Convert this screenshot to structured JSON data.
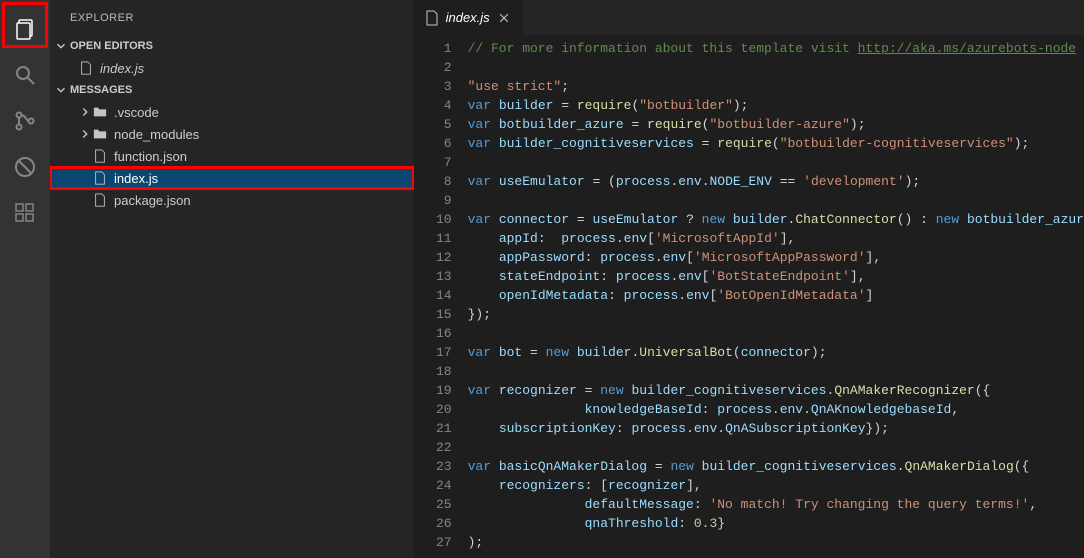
{
  "activityBar": {
    "items": [
      "explorer",
      "search",
      "source-control",
      "debug",
      "extensions"
    ]
  },
  "sidebar": {
    "title": "EXPLORER",
    "openEditorsLabel": "OPEN EDITORS",
    "openEditors": [
      {
        "label": "index.js"
      }
    ],
    "workspaceLabel": "MESSAGES",
    "tree": [
      {
        "type": "folder",
        "label": ".vscode",
        "indent": 1
      },
      {
        "type": "folder",
        "label": "node_modules",
        "indent": 1
      },
      {
        "type": "file",
        "label": "function.json",
        "indent": 1
      },
      {
        "type": "file",
        "label": "index.js",
        "indent": 1,
        "selected": true,
        "highlighted": true
      },
      {
        "type": "file",
        "label": "package.json",
        "indent": 1
      }
    ]
  },
  "tabs": {
    "items": [
      {
        "label": "index.js",
        "active": true
      }
    ]
  },
  "code": {
    "lines": [
      {
        "n": 1,
        "t": "comment",
        "txt": "// For more information about this template visit ",
        "link": "http://aka.ms/azurebots-node"
      },
      {
        "n": 2,
        "t": "blank"
      },
      {
        "n": 3,
        "tokens": [
          [
            "string",
            "\"use strict\""
          ],
          [
            "plain",
            ";"
          ]
        ]
      },
      {
        "n": 4,
        "tokens": [
          [
            "keyword",
            "var "
          ],
          [
            "var",
            "builder"
          ],
          [
            "plain",
            " = "
          ],
          [
            "func",
            "require"
          ],
          [
            "plain",
            "("
          ],
          [
            "string",
            "\"botbuilder\""
          ],
          [
            "plain",
            ");"
          ]
        ]
      },
      {
        "n": 5,
        "tokens": [
          [
            "keyword",
            "var "
          ],
          [
            "var",
            "botbuilder_azure"
          ],
          [
            "plain",
            " = "
          ],
          [
            "func",
            "require"
          ],
          [
            "plain",
            "("
          ],
          [
            "string",
            "\"botbuilder-azure\""
          ],
          [
            "plain",
            ");"
          ]
        ]
      },
      {
        "n": 6,
        "tokens": [
          [
            "keyword",
            "var "
          ],
          [
            "var",
            "builder_cognitiveservices"
          ],
          [
            "plain",
            " = "
          ],
          [
            "func",
            "require"
          ],
          [
            "plain",
            "("
          ],
          [
            "string",
            "\"botbuilder-cognitiveservices\""
          ],
          [
            "plain",
            ");"
          ]
        ]
      },
      {
        "n": 7,
        "t": "blank"
      },
      {
        "n": 8,
        "tokens": [
          [
            "keyword",
            "var "
          ],
          [
            "var",
            "useEmulator"
          ],
          [
            "plain",
            " = ("
          ],
          [
            "var",
            "process"
          ],
          [
            "plain",
            "."
          ],
          [
            "var",
            "env"
          ],
          [
            "plain",
            "."
          ],
          [
            "var",
            "NODE_ENV"
          ],
          [
            "plain",
            " == "
          ],
          [
            "string",
            "'development'"
          ],
          [
            "plain",
            ");"
          ]
        ]
      },
      {
        "n": 9,
        "t": "blank"
      },
      {
        "n": 10,
        "tokens": [
          [
            "keyword",
            "var "
          ],
          [
            "var",
            "connector"
          ],
          [
            "plain",
            " = "
          ],
          [
            "var",
            "useEmulator"
          ],
          [
            "plain",
            " ? "
          ],
          [
            "keyword",
            "new "
          ],
          [
            "var",
            "builder"
          ],
          [
            "plain",
            "."
          ],
          [
            "func",
            "ChatConnector"
          ],
          [
            "plain",
            "() : "
          ],
          [
            "keyword",
            "new "
          ],
          [
            "var",
            "botbuilder_azur"
          ]
        ]
      },
      {
        "n": 11,
        "tokens": [
          [
            "plain",
            "    "
          ],
          [
            "var",
            "appId"
          ],
          [
            "plain",
            ":  "
          ],
          [
            "var",
            "process"
          ],
          [
            "plain",
            "."
          ],
          [
            "var",
            "env"
          ],
          [
            "plain",
            "["
          ],
          [
            "string",
            "'MicrosoftAppId'"
          ],
          [
            "plain",
            "],"
          ]
        ]
      },
      {
        "n": 12,
        "tokens": [
          [
            "plain",
            "    "
          ],
          [
            "var",
            "appPassword"
          ],
          [
            "plain",
            ": "
          ],
          [
            "var",
            "process"
          ],
          [
            "plain",
            "."
          ],
          [
            "var",
            "env"
          ],
          [
            "plain",
            "["
          ],
          [
            "string",
            "'MicrosoftAppPassword'"
          ],
          [
            "plain",
            "],"
          ]
        ]
      },
      {
        "n": 13,
        "tokens": [
          [
            "plain",
            "    "
          ],
          [
            "var",
            "stateEndpoint"
          ],
          [
            "plain",
            ": "
          ],
          [
            "var",
            "process"
          ],
          [
            "plain",
            "."
          ],
          [
            "var",
            "env"
          ],
          [
            "plain",
            "["
          ],
          [
            "string",
            "'BotStateEndpoint'"
          ],
          [
            "plain",
            "],"
          ]
        ]
      },
      {
        "n": 14,
        "tokens": [
          [
            "plain",
            "    "
          ],
          [
            "var",
            "openIdMetadata"
          ],
          [
            "plain",
            ": "
          ],
          [
            "var",
            "process"
          ],
          [
            "plain",
            "."
          ],
          [
            "var",
            "env"
          ],
          [
            "plain",
            "["
          ],
          [
            "string",
            "'BotOpenIdMetadata'"
          ],
          [
            "plain",
            "]"
          ]
        ]
      },
      {
        "n": 15,
        "tokens": [
          [
            "plain",
            "});"
          ]
        ]
      },
      {
        "n": 16,
        "t": "blank"
      },
      {
        "n": 17,
        "tokens": [
          [
            "keyword",
            "var "
          ],
          [
            "var",
            "bot"
          ],
          [
            "plain",
            " = "
          ],
          [
            "keyword",
            "new "
          ],
          [
            "var",
            "builder"
          ],
          [
            "plain",
            "."
          ],
          [
            "func",
            "UniversalBot"
          ],
          [
            "plain",
            "("
          ],
          [
            "var",
            "connector"
          ],
          [
            "plain",
            ");"
          ]
        ]
      },
      {
        "n": 18,
        "t": "blank"
      },
      {
        "n": 19,
        "tokens": [
          [
            "keyword",
            "var "
          ],
          [
            "var",
            "recognizer"
          ],
          [
            "plain",
            " = "
          ],
          [
            "keyword",
            "new "
          ],
          [
            "var",
            "builder_cognitiveservices"
          ],
          [
            "plain",
            "."
          ],
          [
            "func",
            "QnAMakerRecognizer"
          ],
          [
            "plain",
            "({"
          ]
        ]
      },
      {
        "n": 20,
        "tokens": [
          [
            "plain",
            "               "
          ],
          [
            "var",
            "knowledgeBaseId"
          ],
          [
            "plain",
            ": "
          ],
          [
            "var",
            "process"
          ],
          [
            "plain",
            "."
          ],
          [
            "var",
            "env"
          ],
          [
            "plain",
            "."
          ],
          [
            "var",
            "QnAKnowledgebaseId"
          ],
          [
            "plain",
            ","
          ]
        ]
      },
      {
        "n": 21,
        "tokens": [
          [
            "plain",
            "    "
          ],
          [
            "var",
            "subscriptionKey"
          ],
          [
            "plain",
            ": "
          ],
          [
            "var",
            "process"
          ],
          [
            "plain",
            "."
          ],
          [
            "var",
            "env"
          ],
          [
            "plain",
            "."
          ],
          [
            "var",
            "QnASubscriptionKey"
          ],
          [
            "plain",
            "});"
          ]
        ]
      },
      {
        "n": 22,
        "t": "blank"
      },
      {
        "n": 23,
        "tokens": [
          [
            "keyword",
            "var "
          ],
          [
            "var",
            "basicQnAMakerDialog"
          ],
          [
            "plain",
            " = "
          ],
          [
            "keyword",
            "new "
          ],
          [
            "var",
            "builder_cognitiveservices"
          ],
          [
            "plain",
            "."
          ],
          [
            "func",
            "QnAMakerDialog"
          ],
          [
            "plain",
            "({"
          ]
        ]
      },
      {
        "n": 24,
        "tokens": [
          [
            "plain",
            "    "
          ],
          [
            "var",
            "recognizers"
          ],
          [
            "plain",
            ": ["
          ],
          [
            "var",
            "recognizer"
          ],
          [
            "plain",
            "],"
          ]
        ]
      },
      {
        "n": 25,
        "tokens": [
          [
            "plain",
            "               "
          ],
          [
            "var",
            "defaultMessage"
          ],
          [
            "plain",
            ": "
          ],
          [
            "string",
            "'No match! Try changing the query terms!'"
          ],
          [
            "plain",
            ","
          ]
        ]
      },
      {
        "n": 26,
        "tokens": [
          [
            "plain",
            "               "
          ],
          [
            "var",
            "qnaThreshold"
          ],
          [
            "plain",
            ": "
          ],
          [
            "num",
            "0.3"
          ],
          [
            "plain",
            "}"
          ]
        ]
      },
      {
        "n": 27,
        "tokens": [
          [
            "plain",
            ");"
          ]
        ]
      }
    ]
  }
}
